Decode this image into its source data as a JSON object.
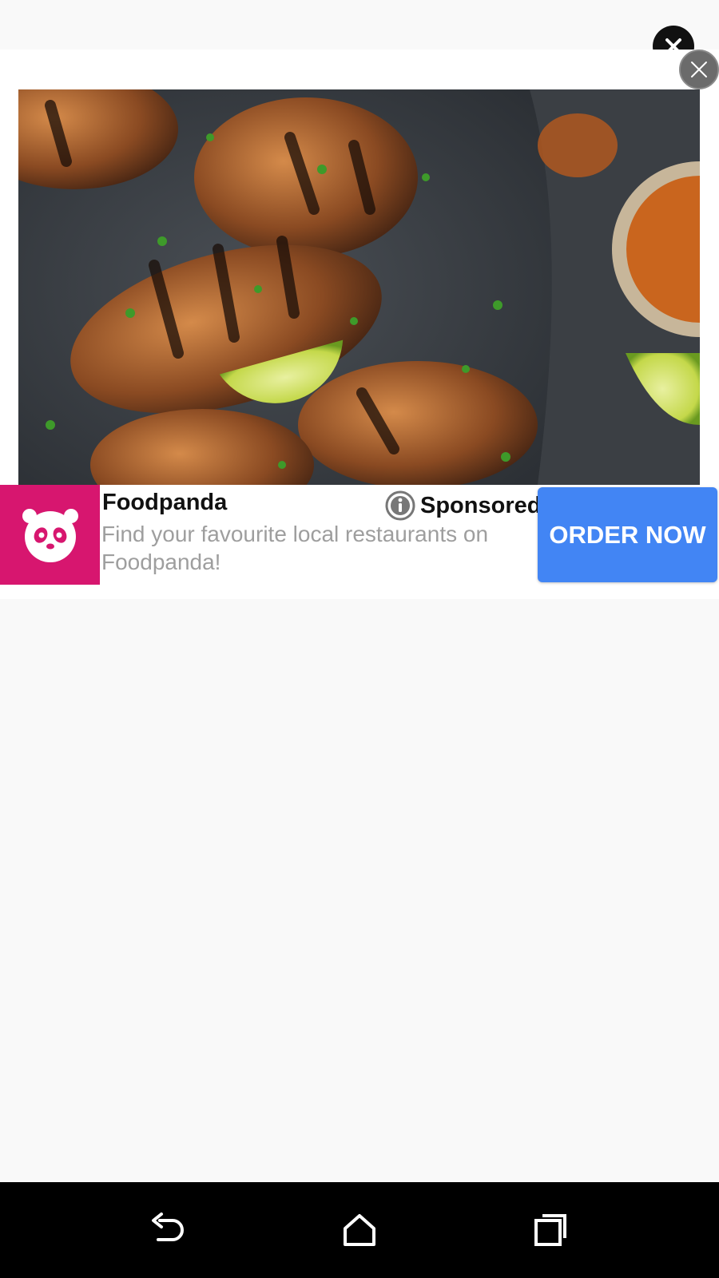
{
  "ad": {
    "advertiser": "Foodpanda",
    "sponsored_label": "Sponsored",
    "body": "Find your favourite local restaurants on Foodpanda!",
    "cta_label": "ORDER NOW",
    "brand_color": "#d7166f",
    "cta_color": "#4285f4"
  },
  "icons": {
    "top_close": "close-icon",
    "ad_close": "close-icon",
    "sponsored": "info-icon",
    "logo": "panda-icon",
    "back": "back-icon",
    "home": "home-icon",
    "recents": "recents-icon"
  }
}
